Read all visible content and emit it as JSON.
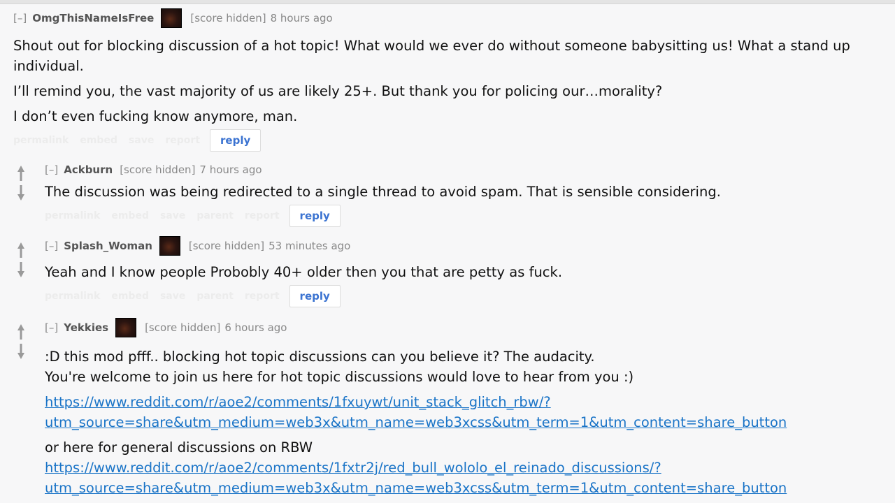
{
  "comments": [
    {
      "collapse": "[–]",
      "author": "OmgThisNameIsFree",
      "score": "[score hidden]",
      "time": "8 hours ago",
      "paragraphs": [
        "Shout out for blocking discussion of a hot topic! What would we ever do without someone babysitting us! What a stand up individual.",
        "I’ll remind you, the vast majority of us are likely 25+. But thank you for policing our…morality?",
        "I don’t even fucking know anymore, man."
      ],
      "buttons": [
        "permalink",
        "embed",
        "save",
        "report"
      ],
      "reply": "reply"
    },
    {
      "collapse": "[–]",
      "author": "Ackburn",
      "score": "[score hidden]",
      "time": "7 hours ago",
      "paragraphs": [
        "The discussion was being redirected to a single thread to avoid spam. That is sensible considering."
      ],
      "buttons": [
        "permalink",
        "embed",
        "save",
        "parent",
        "report"
      ],
      "reply": "reply"
    },
    {
      "collapse": "[–]",
      "author": "Splash_Woman",
      "score": "[score hidden]",
      "time": "53 minutes ago",
      "paragraphs": [
        "Yeah and I know people Probobly 40+ older then you that are petty as fuck."
      ],
      "buttons": [
        "permalink",
        "embed",
        "save",
        "parent",
        "report"
      ],
      "reply": "reply"
    },
    {
      "collapse": "[–]",
      "author": "Yekkies",
      "score": "[score hidden]",
      "time": "6 hours ago",
      "line1": ":D this mod pfff.. blocking hot topic discussions can you believe it? The audacity.",
      "line2": "You're welcome to join us here for hot topic discussions would love to hear from you :)",
      "link1_a": "https://www.reddit.com/r/aoe2/comments/1fxuywt/unit_stack_glitch_rbw/?",
      "link1_b": "utm_source=share&utm_medium=web3x&utm_name=web3xcss&utm_term=1&utm_content=share_button",
      "line3": "or here for general discussions on RBW",
      "link2_a": "https://www.reddit.com/r/aoe2/comments/1fxtr2j/red_bull_wololo_el_reinado_discussions/?",
      "link2_b": "utm_source=share&utm_medium=web3x&utm_name=web3xcss&utm_term=1&utm_content=share_button"
    }
  ]
}
